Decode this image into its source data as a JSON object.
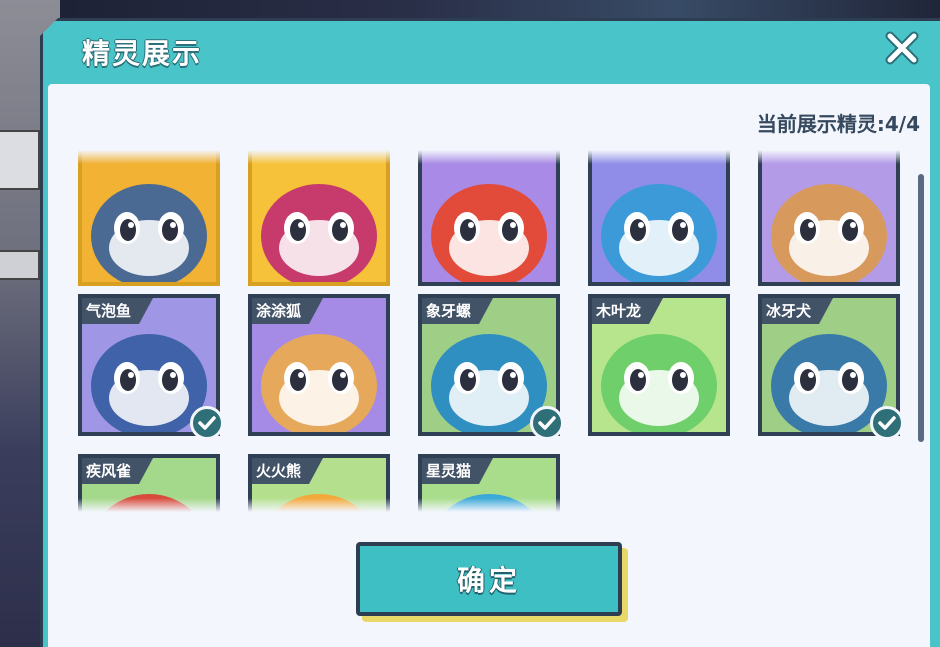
{
  "dialog": {
    "title": "精灵展示",
    "count_label": "当前展示精灵:4/4",
    "confirm_label": "确定",
    "close_icon": "close-x-icon"
  },
  "colors": {
    "panel": "#49c4c8",
    "panel_border": "#2d3e52",
    "body": "#f3f6fc",
    "name_tag": "#435367",
    "check": "#2f6f78",
    "selected_border": "#d8a021"
  },
  "rows": [
    {
      "cards": [
        {
          "name": "",
          "selected": true,
          "checked": false,
          "bg": "#f2b233",
          "creature": "#4b6a93"
        },
        {
          "name": "",
          "selected": true,
          "checked": false,
          "bg": "#f6c23a",
          "creature": "#c63b6b"
        },
        {
          "name": "",
          "selected": false,
          "checked": false,
          "bg": "#a98ae6",
          "creature": "#e24a3a"
        },
        {
          "name": "",
          "selected": false,
          "checked": false,
          "bg": "#8f8de8",
          "creature": "#3c9ad8"
        },
        {
          "name": "",
          "selected": false,
          "checked": false,
          "bg": "#b49be8",
          "creature": "#d89a5c"
        }
      ]
    },
    {
      "cards": [
        {
          "name": "气泡鱼",
          "selected": false,
          "checked": true,
          "bg": "#9f96e6",
          "creature": "#3f62a8"
        },
        {
          "name": "涂涂狐",
          "selected": false,
          "checked": false,
          "bg": "#a68be6",
          "creature": "#e6a85a"
        },
        {
          "name": "象牙螺",
          "selected": false,
          "checked": true,
          "bg": "#9fcf86",
          "creature": "#2f8fc0"
        },
        {
          "name": "木叶龙",
          "selected": false,
          "checked": false,
          "bg": "#b7e58e",
          "creature": "#6fcf6a"
        },
        {
          "name": "冰牙犬",
          "selected": false,
          "checked": true,
          "bg": "#9fcf86",
          "creature": "#3a7aa8"
        }
      ]
    },
    {
      "cards": [
        {
          "name": "疾风雀",
          "selected": false,
          "checked": false,
          "bg": "#a4d88a",
          "creature": "#d84a3a"
        },
        {
          "name": "火火熊",
          "selected": false,
          "checked": false,
          "bg": "#b4e08e",
          "creature": "#f4a83a"
        },
        {
          "name": "星灵猫",
          "selected": false,
          "checked": false,
          "bg": "#a9dd8c",
          "creature": "#3aa8d8"
        }
      ]
    }
  ]
}
